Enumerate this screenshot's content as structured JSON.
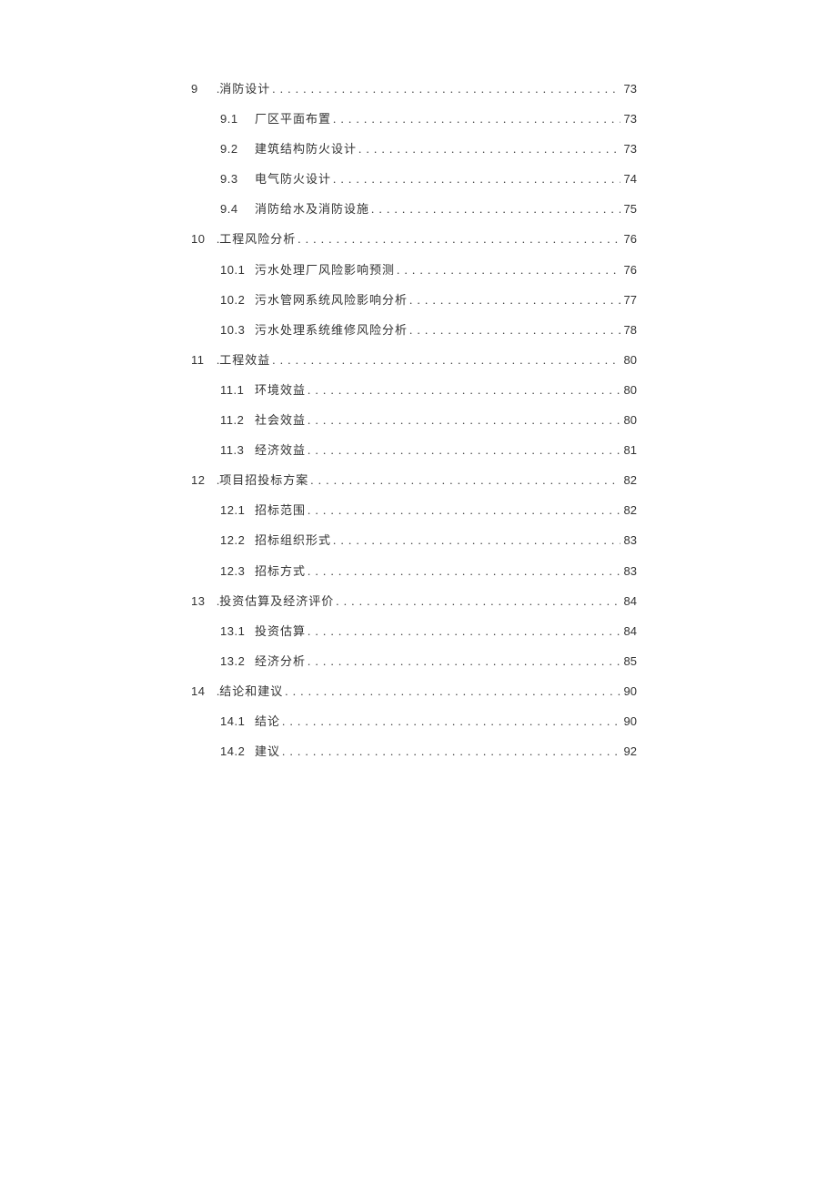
{
  "toc": [
    {
      "level": 1,
      "num": "9",
      "prefix": ".",
      "title": "消防设计",
      "page": "73"
    },
    {
      "level": 2,
      "num": "9.1",
      "title": "厂区平面布置",
      "page": "73"
    },
    {
      "level": 2,
      "num": "9.2",
      "title": "建筑结构防火设计",
      "page": "73"
    },
    {
      "level": 2,
      "num": "9.3",
      "title": "电气防火设计",
      "page": "74"
    },
    {
      "level": 2,
      "num": "9.4",
      "title": "消防给水及消防设施",
      "page": "75"
    },
    {
      "level": 1,
      "num": "10",
      "prefix": ".",
      "title": "工程风险分析",
      "page": "76"
    },
    {
      "level": 2,
      "num": "10.1",
      "title": "污水处理厂风险影响预测",
      "page": "76"
    },
    {
      "level": 2,
      "num": "10.2",
      "title": "污水管网系统风险影响分析",
      "page": "77"
    },
    {
      "level": 2,
      "num": "10.3",
      "title": "污水处理系统维修风险分析",
      "page": "78"
    },
    {
      "level": 1,
      "num": "11",
      "prefix": ".",
      "title": "工程效益",
      "page": "80"
    },
    {
      "level": 2,
      "num": "11.1",
      "title": "环境效益",
      "page": "80"
    },
    {
      "level": 2,
      "num": "11.2",
      "title": "社会效益",
      "page": "80"
    },
    {
      "level": 2,
      "num": "11.3",
      "title": "经济效益",
      "page": "81"
    },
    {
      "level": 1,
      "num": "12",
      "prefix": ".",
      "title": "项目招投标方案",
      "page": "82"
    },
    {
      "level": 2,
      "num": "12.1",
      "title": "招标范围",
      "page": "82"
    },
    {
      "level": 2,
      "num": "12.2",
      "title": "招标组织形式",
      "page": "83"
    },
    {
      "level": 2,
      "num": "12.3",
      "title": "招标方式",
      "page": "83"
    },
    {
      "level": 1,
      "num": "13",
      "prefix": ".",
      "title": "投资估算及经济评价",
      "page": "84"
    },
    {
      "level": 2,
      "num": "13.1",
      "title": "投资估算",
      "page": "84"
    },
    {
      "level": 2,
      "num": "13.2",
      "title": "经济分析",
      "page": "85"
    },
    {
      "level": 1,
      "num": "14",
      "prefix": ".",
      "title": "结论和建议",
      "page": "90"
    },
    {
      "level": 2,
      "num": "14.1",
      "title": "结论",
      "page": "90"
    },
    {
      "level": 2,
      "num": "14.2",
      "title": "建议",
      "page": "92"
    }
  ]
}
